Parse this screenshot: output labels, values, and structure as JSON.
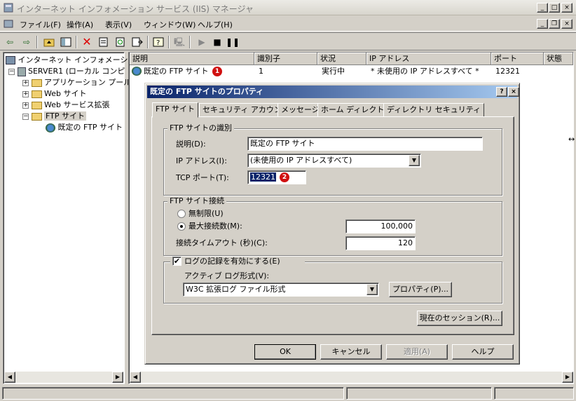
{
  "window": {
    "title": "インターネット インフォメーション サービス (IIS) マネージャ"
  },
  "menu": {
    "items": [
      "ファイル(F)",
      "操作(A)",
      "表示(V)",
      "ウィンドウ(W)",
      "ヘルプ(H)"
    ]
  },
  "tree": {
    "root": "インターネット インフォメーション",
    "server": "SERVER1 (ローカル コンピ",
    "items": [
      "アプリケーション プール",
      "Web サイト",
      "Web サービス拡張",
      "FTP サイト",
      "既定の FTP サイト"
    ]
  },
  "list": {
    "columns": [
      "説明",
      "識別子",
      "状況",
      "IP アドレス",
      "ポート",
      "状態"
    ],
    "rows": [
      {
        "desc": "既定の FTP サイト",
        "id": "1",
        "status": "実行中",
        "ip": "* 未使用の IP アドレスすべて *",
        "port": "12321",
        "state": ""
      }
    ]
  },
  "annotations": {
    "one": "1",
    "two": "2"
  },
  "dialog": {
    "title": "既定の FTP サイトのプロパティ",
    "help_btn": "?",
    "close_btn": "×",
    "tabs": [
      "FTP サイト",
      "セキュリティ アカウント",
      "メッセージ",
      "ホーム ディレクトリ",
      "ディレクトリ セキュリティ"
    ],
    "ident_group": "FTP サイトの識別",
    "desc_label": "説明(D):",
    "desc_value": "既定の FTP サイト",
    "ip_label": "IP アドレス(I):",
    "ip_value": "(未使用の IP アドレスすべて)",
    "port_label": "TCP ポート(T):",
    "port_value": "12321",
    "conn_group": "FTP サイト接続",
    "unlimited_label": "無制限(U)",
    "max_label": "最大接続数(M):",
    "max_value": "100,000",
    "timeout_label": "接続タイムアウト (秒)(C):",
    "timeout_value": "120",
    "log_check_label": "ログの記録を有効にする(E)",
    "log_format_label": "アクティブ ログ形式(V):",
    "log_format_value": "W3C 拡張ログ ファイル形式",
    "props_btn": "プロパティ(P)...",
    "sessions_btn": "現在のセッション(R)...",
    "ok_btn": "OK",
    "cancel_btn": "キャンセル",
    "apply_btn": "適用(A)",
    "help2_btn": "ヘルプ"
  }
}
